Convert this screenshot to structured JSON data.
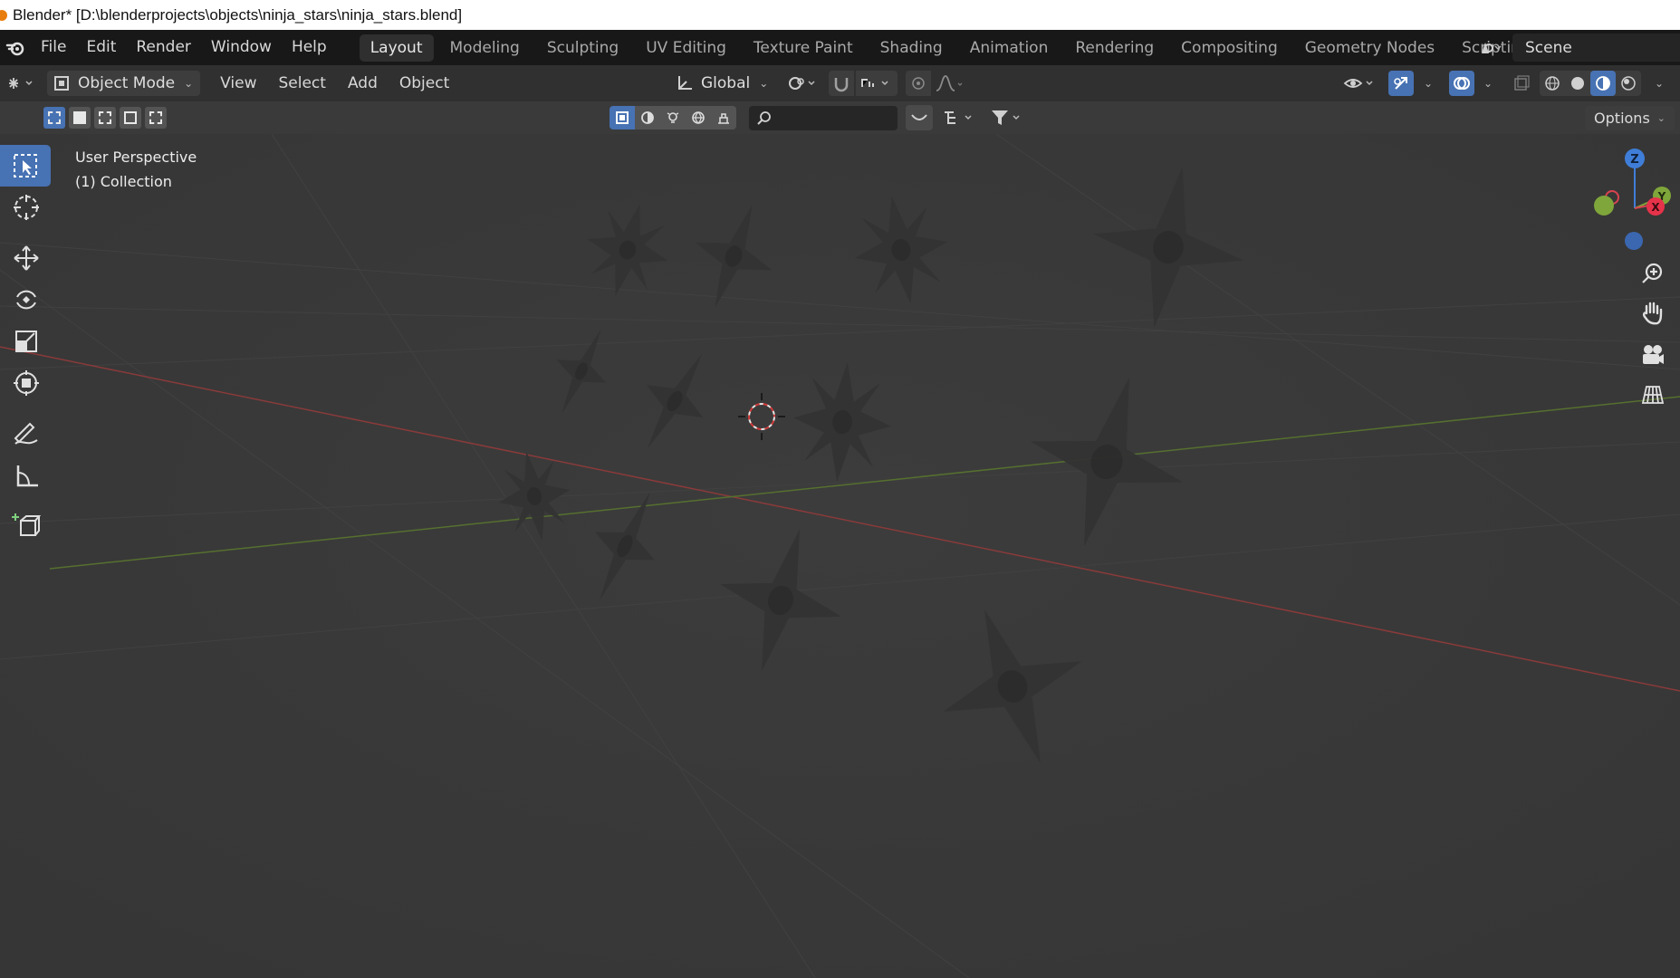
{
  "window": {
    "title": "Blender* [D:\\blenderprojects\\objects\\ninja_stars\\ninja_stars.blend]"
  },
  "menu": {
    "items": [
      "File",
      "Edit",
      "Render",
      "Window",
      "Help"
    ]
  },
  "workspaces": {
    "tabs": [
      "Layout",
      "Modeling",
      "Sculpting",
      "UV Editing",
      "Texture Paint",
      "Shading",
      "Animation",
      "Rendering",
      "Compositing",
      "Geometry Nodes",
      "Scripting"
    ],
    "active": "Layout",
    "add_symbol": "+"
  },
  "scene": {
    "name": "Scene"
  },
  "header": {
    "mode": "Object Mode",
    "menus": [
      "View",
      "Select",
      "Add",
      "Object"
    ],
    "transform_orientation": "Global"
  },
  "viewport": {
    "view_name": "User Perspective",
    "collection": "(1) Collection"
  },
  "options": {
    "label": "Options"
  },
  "search": {
    "placeholder": ""
  },
  "gizmo": {
    "z_label": "Z",
    "y_label": "Y",
    "x_label": "X"
  },
  "colors": {
    "accent": "#4772b3",
    "x_axis": "#d9434f",
    "y_axis": "#7fa63a",
    "z_axis": "#3f7ed8"
  }
}
